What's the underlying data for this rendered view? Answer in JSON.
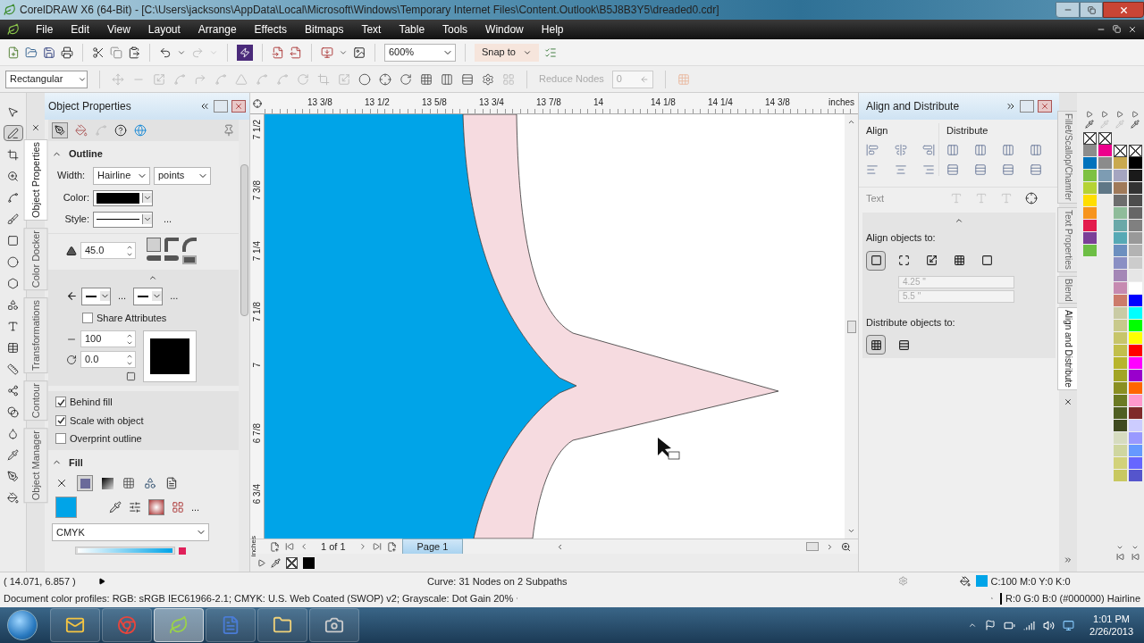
{
  "window": {
    "title": "CorelDRAW X6 (64-Bit) - [C:\\Users\\jacksons\\AppData\\Local\\Microsoft\\Windows\\Temporary Internet Files\\Content.Outlook\\B5J8B3Y5\\dreaded0.cdr]"
  },
  "menu": [
    "File",
    "Edit",
    "View",
    "Layout",
    "Arrange",
    "Effects",
    "Bitmaps",
    "Text",
    "Table",
    "Tools",
    "Window",
    "Help"
  ],
  "standard_toolbar": {
    "zoom": "600%",
    "snap": "Snap to"
  },
  "property_bar": {
    "mode": "Rectangular",
    "reduce_nodes_label": "Reduce Nodes",
    "reduce_nodes_value": "0"
  },
  "toolbox": [
    {
      "selected": false
    },
    {
      "selected": true
    },
    {
      "selected": false
    },
    {
      "selected": false
    },
    {
      "selected": false
    },
    {
      "selected": false
    },
    {
      "selected": false
    },
    {
      "selected": false
    },
    {
      "selected": false
    },
    {
      "selected": false
    },
    {
      "selected": false
    },
    {
      "selected": false
    },
    {
      "selected": false
    },
    {
      "selected": false
    },
    {
      "selected": false
    },
    {
      "selected": false
    },
    {
      "selected": false
    },
    {
      "selected": false
    },
    {
      "selected": false
    }
  ],
  "object_properties": {
    "title": "Object Properties",
    "side_tabs": [
      {
        "label": "Object Properties",
        "selected": true
      },
      {
        "label": "Color Docker",
        "selected": false
      },
      {
        "label": "Transformations",
        "selected": false
      },
      {
        "label": "Contour",
        "selected": false
      },
      {
        "label": "Object Manager",
        "selected": false
      }
    ],
    "outline": {
      "title": "Outline",
      "width_label": "Width:",
      "width": "Hairline",
      "units": "points",
      "color_label": "Color:",
      "style_label": "Style:",
      "style_more": "...",
      "miter": "45.0",
      "arrow_start_more": "...",
      "arrow_end_more": "...",
      "share_attributes": {
        "label": "Share Attributes",
        "checked": false
      },
      "stretch": "100",
      "angle": "0.0",
      "options": [
        {
          "label": "Behind fill",
          "checked": true
        },
        {
          "label": "Scale with object",
          "checked": true
        },
        {
          "label": "Overprint outline",
          "checked": false
        }
      ]
    },
    "fill": {
      "title": "Fill",
      "more": "...",
      "model": "CMYK",
      "slider": {
        "level": 1
      }
    }
  },
  "rulers": {
    "horizontal": [
      "13 3/8",
      "13 1/2",
      "13 5/8",
      "13 3/4",
      "13 7/8",
      "14",
      "14 1/8",
      "14 1/4",
      "14 3/8"
    ],
    "horizontal_unit": "inches",
    "vertical": [
      "7 1/2",
      "7 3/8",
      "7 1/4",
      "7 1/8",
      "7",
      "6 7/8",
      "6 3/4"
    ],
    "vertical_unit": "inches"
  },
  "page_nav": {
    "count": "1 of 1",
    "page_tab": "Page 1"
  },
  "align_docker": {
    "title": "Align and Distribute",
    "align_label": "Align",
    "distribute_label": "Distribute",
    "text_label": "Text",
    "align_to_label": "Align objects to:",
    "align_to": [
      {
        "selected": true
      },
      {
        "selected": false
      },
      {
        "selected": false
      },
      {
        "selected": false
      },
      {
        "selected": false
      }
    ],
    "x": "4.25 \"",
    "y": "5.5 \"",
    "distribute_to_label": "Distribute objects to:",
    "distribute_to": [
      {
        "selected": true
      },
      {
        "selected": false
      }
    ]
  },
  "right_tabs": [
    {
      "label": "Fillet/Scallop/Chamfer",
      "selected": false
    },
    {
      "label": "Text Properties",
      "selected": false
    },
    {
      "label": "Blend",
      "selected": false
    },
    {
      "label": "Align and Distribute",
      "selected": true
    }
  ],
  "palette": {
    "columns": [
      [
        {
          "color": "#8c8c8c"
        },
        {
          "color": "#0072bc"
        },
        {
          "color": "#7dc142"
        },
        {
          "color": "#b5d334"
        },
        {
          "color": "#ffde00"
        },
        {
          "color": "#f7941d"
        },
        {
          "color": "#e31b4c"
        },
        {
          "color": "#7b3f98"
        },
        {
          "color": "#6dbe45"
        }
      ],
      [
        {
          "color": "#ec008c"
        },
        {
          "color": "#8b8b8b"
        },
        {
          "color": "#7d9cb3"
        },
        {
          "color": "#5f7786"
        }
      ],
      [
        {
          "color": "#c9a94f"
        },
        {
          "color": "#a5a5c0"
        },
        {
          "color": "#a07a5a"
        },
        {
          "color": "#6d6d6d"
        },
        {
          "color": "#8fbc9a"
        },
        {
          "color": "#6aa8a8"
        },
        {
          "color": "#56a9b5"
        },
        {
          "color": "#6c8fbf"
        },
        {
          "color": "#8a8fc4"
        },
        {
          "color": "#a487b6"
        },
        {
          "color": "#c68ab1"
        },
        {
          "color": "#cc7b6b"
        },
        {
          "color": "#c9cba5"
        },
        {
          "color": "#c8c98c"
        },
        {
          "color": "#c7c56a"
        },
        {
          "color": "#c2bf4b"
        },
        {
          "color": "#b8b52c"
        },
        {
          "color": "#a2a524"
        },
        {
          "color": "#8a8f22"
        },
        {
          "color": "#6b7a23"
        },
        {
          "color": "#4f5f22"
        },
        {
          "color": "#3f4a20"
        },
        {
          "color": "#d6dcc0"
        },
        {
          "color": "#cfd6a0"
        },
        {
          "color": "#d2d27a"
        },
        {
          "color": "#c8c860"
        }
      ],
      [
        {
          "color": "#000000"
        },
        {
          "color": "#1a1a1a"
        },
        {
          "color": "#333333"
        },
        {
          "color": "#4d4d4d"
        },
        {
          "color": "#666666"
        },
        {
          "color": "#808080"
        },
        {
          "color": "#999999"
        },
        {
          "color": "#b3b3b3"
        },
        {
          "color": "#cccccc"
        },
        {
          "color": "#e6e6e6"
        },
        {
          "color": "#ffffff"
        },
        {
          "color": "#0000ff"
        },
        {
          "color": "#00ffff"
        },
        {
          "color": "#00ff00"
        },
        {
          "color": "#ffff00"
        },
        {
          "color": "#ff0000"
        },
        {
          "color": "#ff00ff"
        },
        {
          "color": "#9900cc"
        },
        {
          "color": "#ff6600"
        },
        {
          "color": "#ff99cc"
        },
        {
          "color": "#7f2a2a"
        },
        {
          "color": "#ccccff"
        },
        {
          "color": "#9999ff"
        },
        {
          "color": "#6699ff"
        },
        {
          "color": "#6666ff"
        },
        {
          "color": "#5555cc"
        }
      ]
    ]
  },
  "status_bar": {
    "coords": "( 14.071, 6.857 )",
    "selection": "Curve: 31 Nodes on 2 Subpaths",
    "fill": "C:100 M:0 Y:0 K:0",
    "profiles": "Document color profiles: RGB: sRGB IEC61966-2.1; CMYK: U.S. Web Coated (SWOP) v2; Grayscale: Dot Gain 20%",
    "outline": "R:0 G:0 B:0 (#000000) Hairline"
  },
  "taskbar": {
    "apps": [
      {
        "selected": false
      },
      {
        "selected": false
      },
      {
        "selected": true
      },
      {
        "selected": false
      },
      {
        "selected": false
      },
      {
        "selected": false
      }
    ],
    "time": "1:01 PM",
    "date": "2/26/2013"
  }
}
